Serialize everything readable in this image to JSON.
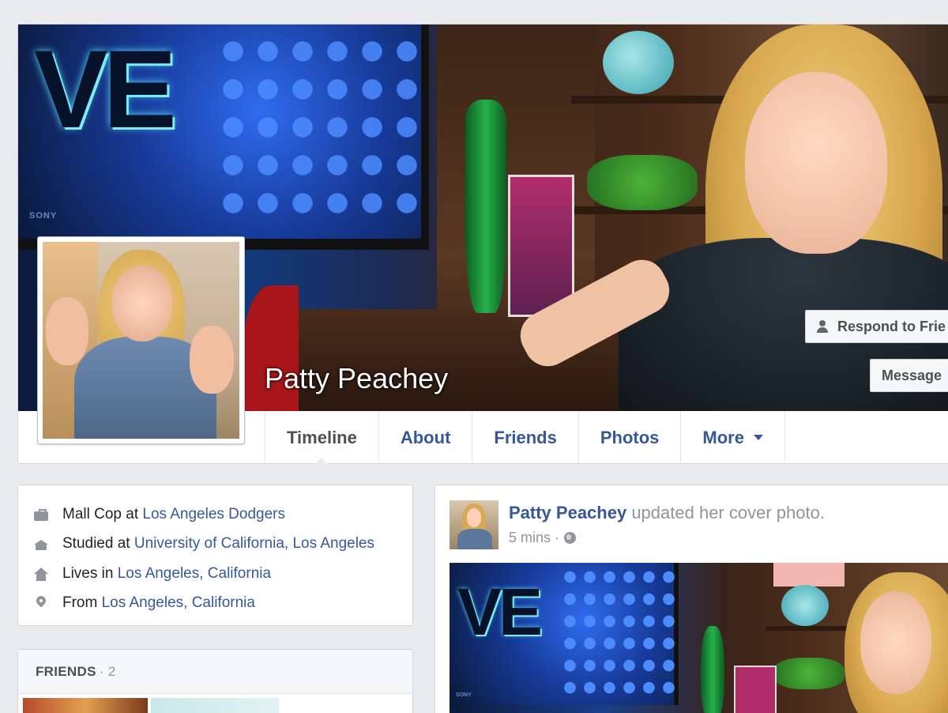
{
  "profile": {
    "name": "Patty Peachey",
    "buttons": {
      "respond": "Respond to Frie",
      "message": "Message"
    },
    "tabs": [
      "Timeline",
      "About",
      "Friends",
      "Photos",
      "More"
    ],
    "active_tab": "Timeline"
  },
  "cover_text": {
    "tv_letters": "VE",
    "tv_brand": "SONY"
  },
  "intro": {
    "work": {
      "prefix": "Mall Cop at ",
      "link": "Los Angeles Dodgers"
    },
    "education": {
      "prefix": "Studied at ",
      "link": "University of California, Los Angeles"
    },
    "lives": {
      "prefix": "Lives in ",
      "link": "Los Angeles, California"
    },
    "from": {
      "prefix": "From ",
      "link": "Los Angeles, California"
    }
  },
  "friends": {
    "header": "FRIENDS",
    "count": "· 2"
  },
  "post": {
    "author": "Patty Peachey",
    "action": " updated her cover photo.",
    "time": "5 mins ·",
    "image_letters": "VE",
    "image_brand": "SONY"
  },
  "colors": {
    "link": "#365899",
    "page_bg": "#e9ebee",
    "muted": "#90949c"
  }
}
